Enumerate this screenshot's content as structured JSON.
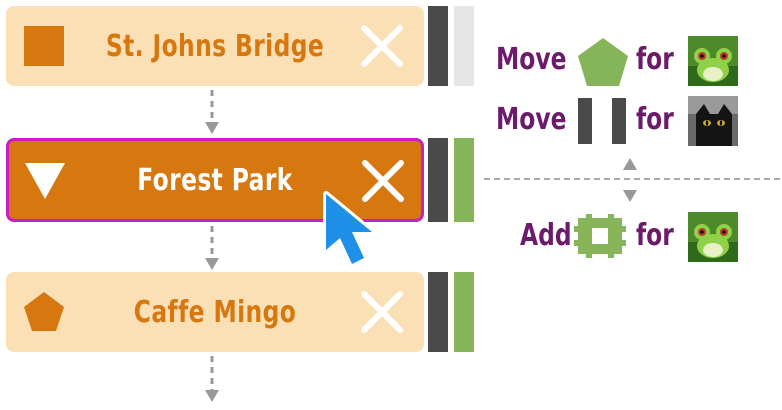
{
  "route": {
    "stops": [
      {
        "label": "St. Johns Bridge",
        "shape": "square-icon",
        "state": "default"
      },
      {
        "label": "Forest Park",
        "shape": "triangle-down-icon",
        "state": "selected"
      },
      {
        "label": "Caffe Mingo",
        "shape": "pentagon-icon",
        "state": "default"
      }
    ]
  },
  "legend": {
    "moves": [
      {
        "verb": "Move",
        "for_word": "for",
        "token": "pentagon-icon",
        "avatar": "frog-avatar"
      },
      {
        "verb": "Move",
        "for_word": "for",
        "token": "two-bars-icon",
        "avatar": "cat-avatar"
      }
    ],
    "add": {
      "verb": "Add",
      "for_word": "for",
      "token": "green-plus-block-icon",
      "avatar": "frog-avatar"
    }
  },
  "colors": {
    "orange": "#d6780f",
    "light_orange": "#fbe0b6",
    "magenta_border": "#c81ec8",
    "purple_text": "#6c1a6c",
    "green": "#86b458",
    "dark_bar": "#4a4a4a"
  }
}
